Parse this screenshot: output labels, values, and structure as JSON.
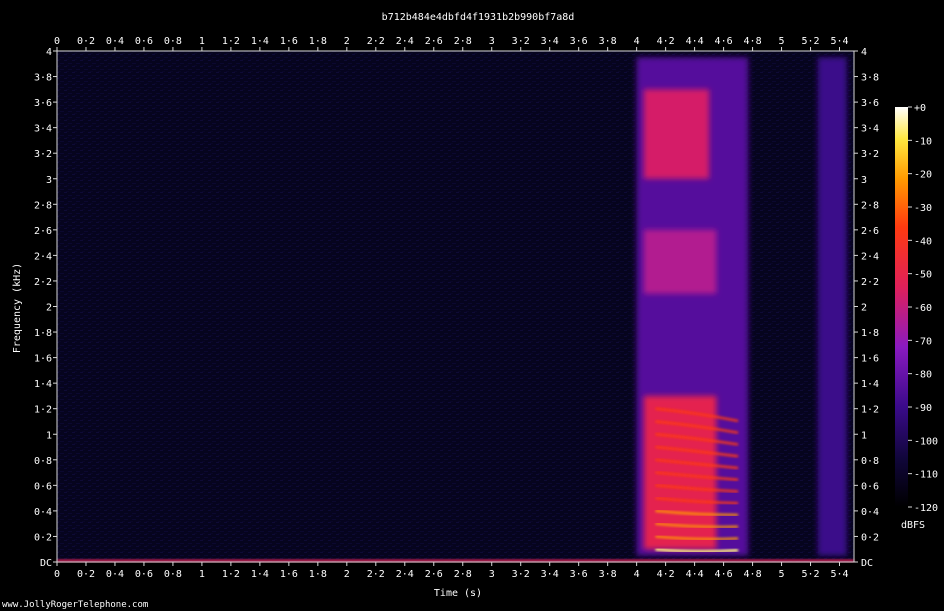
{
  "chart_data": {
    "type": "heatmap",
    "title": "b712b484e4dbfd4f1931b2b990bf7a8d",
    "xlabel": "Time (s)",
    "ylabel": "Frequency (kHz)",
    "xlim": [
      0,
      5.5
    ],
    "ylim": [
      0,
      4
    ],
    "x_ticks": [
      "0",
      "0·2",
      "0·4",
      "0·6",
      "0·8",
      "1",
      "1·2",
      "1·4",
      "1·6",
      "1·8",
      "2",
      "2·2",
      "2·4",
      "2·6",
      "2·8",
      "3",
      "3·2",
      "3·4",
      "3·6",
      "3·8",
      "4",
      "4·2",
      "4·4",
      "4·6",
      "4·8",
      "5",
      "5·2",
      "5·4"
    ],
    "y_ticks": [
      "DC",
      "0·2",
      "0·4",
      "0·6",
      "0·8",
      "1",
      "1·2",
      "1·4",
      "1·6",
      "1·8",
      "2",
      "2·2",
      "2·4",
      "2·6",
      "2·8",
      "3",
      "3·2",
      "3·4",
      "3·6",
      "3·8",
      "4"
    ],
    "colorbar": {
      "label": "dBFS",
      "ticks": [
        "+0",
        "-10",
        "-20",
        "-30",
        "-40",
        "-50",
        "-60",
        "-70",
        "-80",
        "-90",
        "-100",
        "-110",
        "-120"
      ],
      "range": [
        -120,
        0
      ],
      "colors": [
        "#000000",
        "#10063a",
        "#3a0a8a",
        "#8a1ac0",
        "#e0205a",
        "#ff3a10",
        "#ff9a00",
        "#ffe840",
        "#ffffff"
      ]
    },
    "background_level_dbfs": -115,
    "regions": [
      {
        "t": [
          4.0,
          4.77
        ],
        "f": [
          0.05,
          3.95
        ],
        "level_dbfs": -85
      },
      {
        "t": [
          4.05,
          4.5
        ],
        "f": [
          3.0,
          3.7
        ],
        "level_dbfs": -62
      },
      {
        "t": [
          4.05,
          4.55
        ],
        "f": [
          2.1,
          2.6
        ],
        "level_dbfs": -68
      },
      {
        "t": [
          4.05,
          4.55
        ],
        "f": [
          0.1,
          1.3
        ],
        "level_dbfs": -58
      },
      {
        "t": [
          5.25,
          5.45
        ],
        "f": [
          0.05,
          3.95
        ],
        "level_dbfs": -90
      },
      {
        "t": [
          0.0,
          5.5
        ],
        "f": [
          0.0,
          0.02
        ],
        "level_dbfs": -60
      }
    ],
    "harmonics_khz_at_start": [
      0.1,
      0.2,
      0.3,
      0.4,
      0.5,
      0.6,
      0.7,
      0.8,
      0.9,
      1.0,
      1.1,
      1.2
    ],
    "harmonics_time_range": [
      4.13,
      4.7
    ]
  },
  "footer": {
    "watermark": "www.JollyRogerTelephone.com"
  }
}
